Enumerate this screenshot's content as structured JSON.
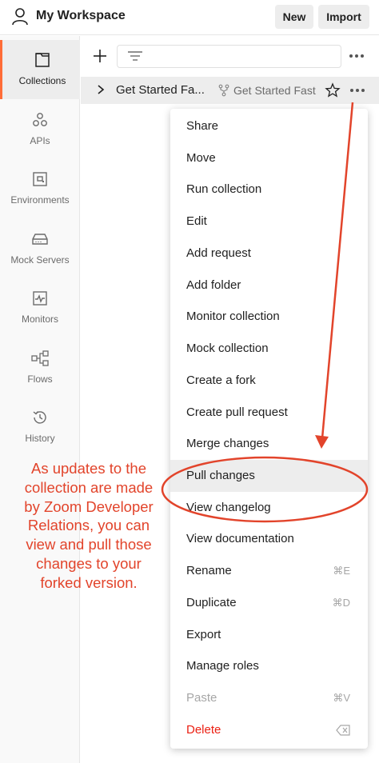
{
  "header": {
    "workspace_title": "My Workspace",
    "new_label": "New",
    "import_label": "Import"
  },
  "sidebar": {
    "items": [
      {
        "label": "Collections",
        "icon": "collections-icon",
        "active": true
      },
      {
        "label": "APIs",
        "icon": "apis-icon"
      },
      {
        "label": "Environments",
        "icon": "environments-icon"
      },
      {
        "label": "Mock Servers",
        "icon": "mock-servers-icon"
      },
      {
        "label": "Monitors",
        "icon": "monitors-icon"
      },
      {
        "label": "Flows",
        "icon": "flows-icon"
      },
      {
        "label": "History",
        "icon": "history-icon"
      }
    ]
  },
  "collection": {
    "name": "Get Started Fa...",
    "fork_label": "Get Started Fast"
  },
  "menu": {
    "items": [
      {
        "label": "Share"
      },
      {
        "label": "Move"
      },
      {
        "label": "Run collection"
      },
      {
        "label": "Edit"
      },
      {
        "label": "Add request"
      },
      {
        "label": "Add folder"
      },
      {
        "label": "Monitor collection"
      },
      {
        "label": "Mock collection"
      },
      {
        "label": "Create a fork"
      },
      {
        "label": "Create pull request"
      },
      {
        "label": "Merge changes"
      },
      {
        "label": "Pull changes",
        "highlighted": true
      },
      {
        "label": "View changelog"
      },
      {
        "label": "View documentation"
      },
      {
        "label": "Rename",
        "shortcut": "⌘E"
      },
      {
        "label": "Duplicate",
        "shortcut": "⌘D"
      },
      {
        "label": "Export"
      },
      {
        "label": "Manage roles"
      },
      {
        "label": "Paste",
        "shortcut": "⌘V",
        "disabled": true
      },
      {
        "label": "Delete",
        "danger": true
      }
    ]
  },
  "annotation": {
    "lines": [
      "As updates to the",
      "collection are made",
      "by Zoom Developer",
      "Relations, you can",
      "view and pull those",
      "changes to your",
      "forked version."
    ],
    "color": "#e2442b"
  },
  "colors": {
    "accent": "#ff6c37",
    "danger": "#eb2013",
    "annotation": "#e2442b"
  }
}
